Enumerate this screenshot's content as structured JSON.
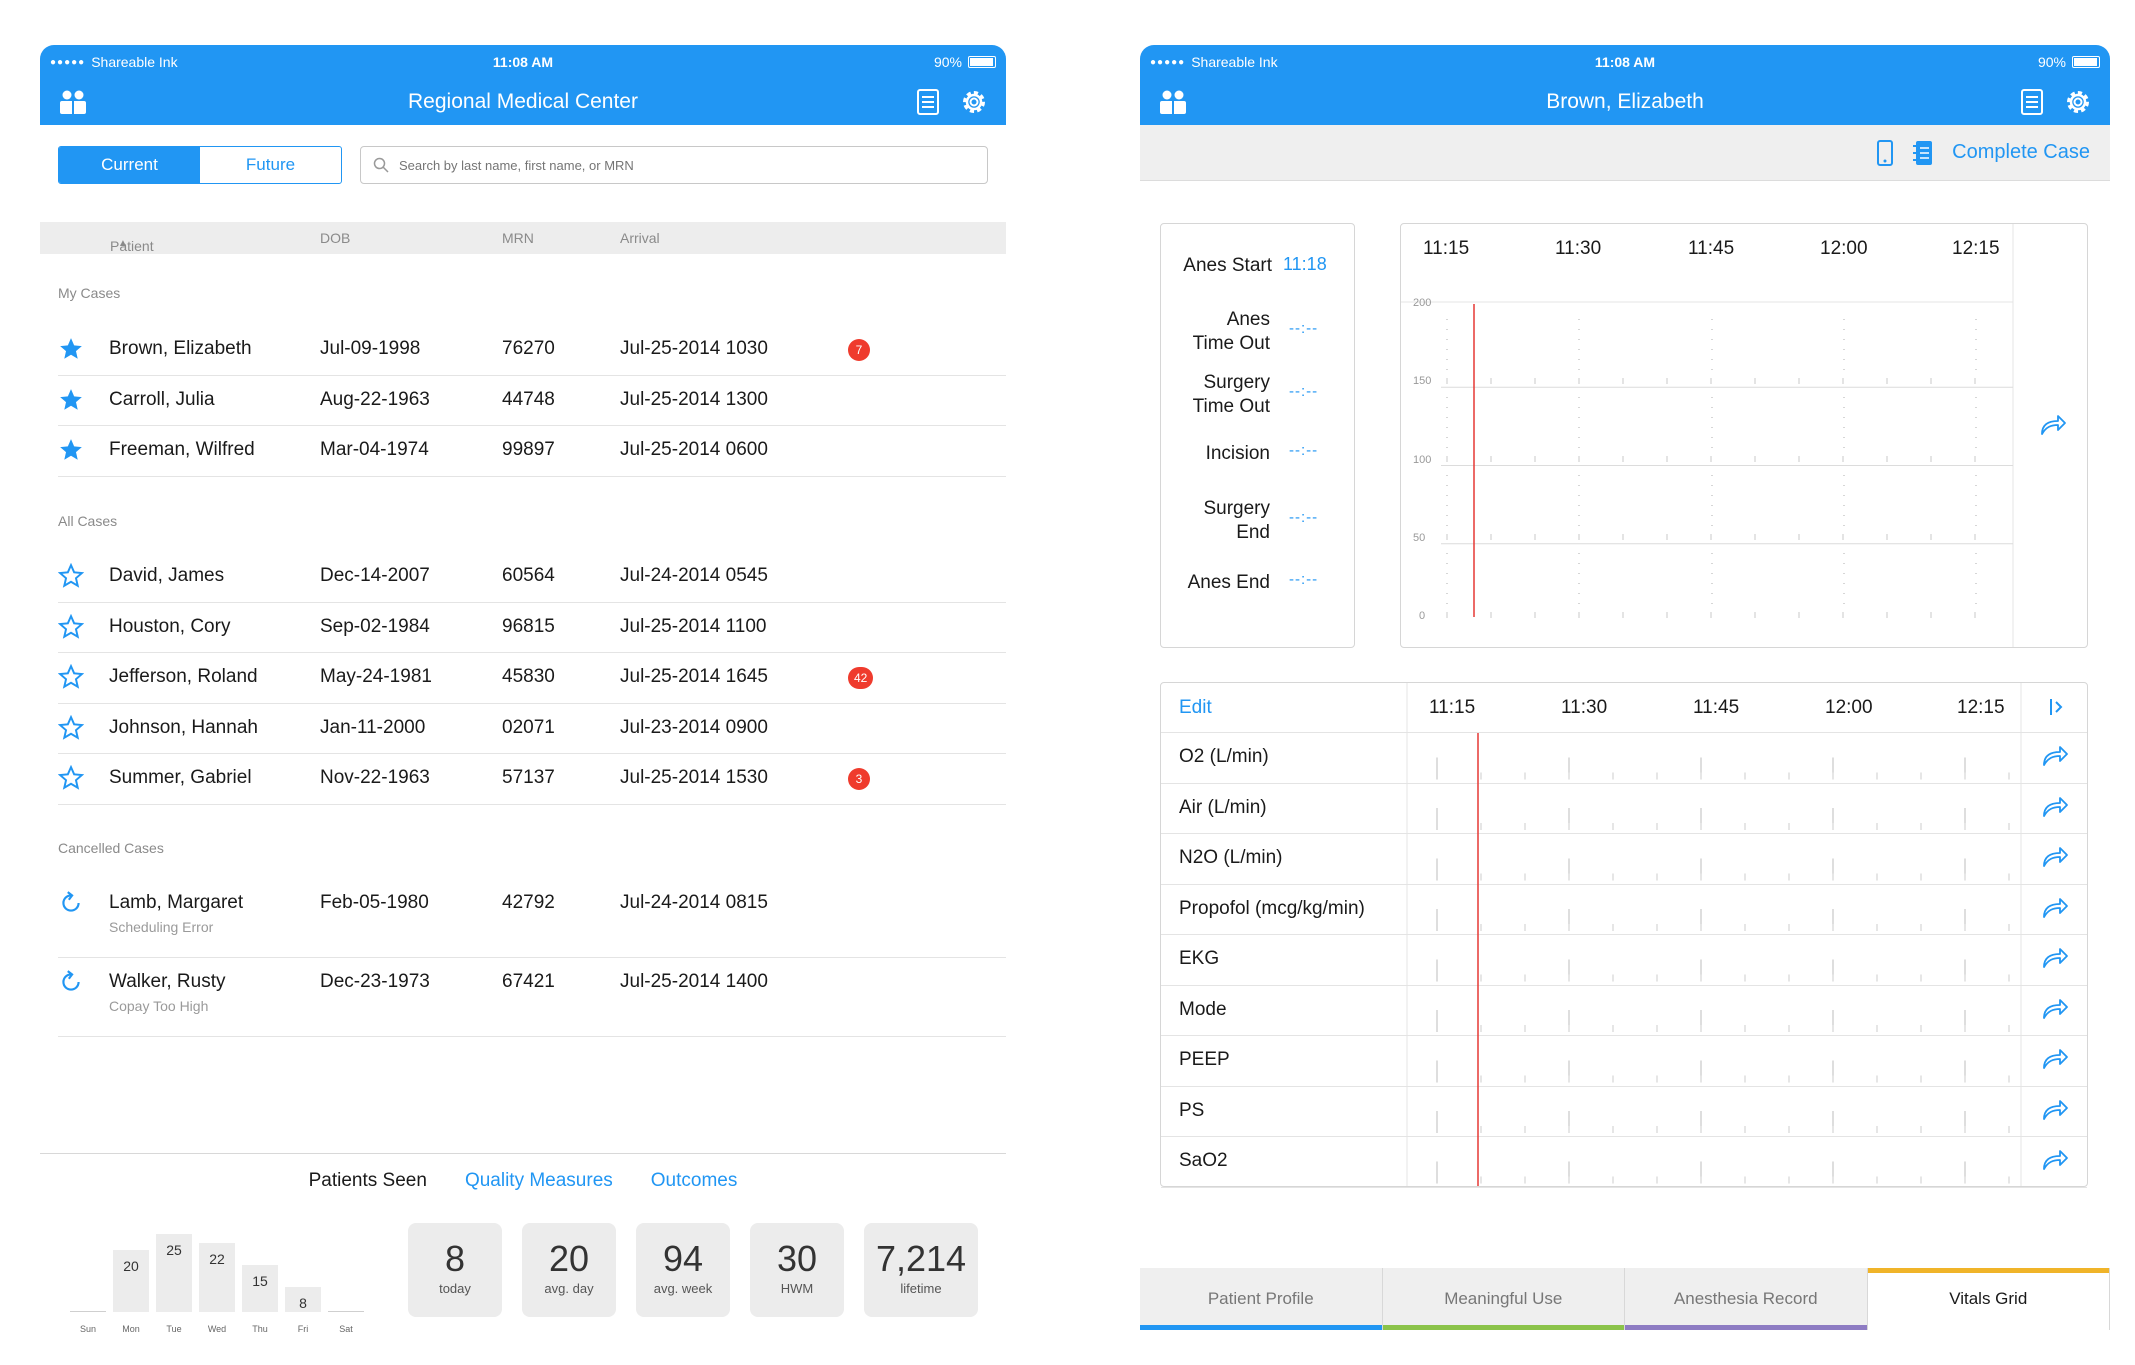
{
  "status": {
    "carrier": "Shareable Ink",
    "time": "11:08 AM",
    "battery": "90%"
  },
  "left": {
    "title": "Regional Medical Center",
    "segment": {
      "current": "Current",
      "future": "Future"
    },
    "search_placeholder": "Search by last name, first name, or MRN",
    "columns": {
      "patient": "Patient",
      "dob": "DOB",
      "mrn": "MRN",
      "arrival": "Arrival"
    },
    "sections": {
      "my": "My Cases",
      "all": "All Cases",
      "cancelled": "Cancelled Cases"
    },
    "my_cases": [
      {
        "name": "Brown, Elizabeth",
        "dob": "Jul-09-1998",
        "mrn": "76270",
        "arrival": "Jul-25-2014 1030",
        "badge": "7"
      },
      {
        "name": "Carroll, Julia",
        "dob": "Aug-22-1963",
        "mrn": "44748",
        "arrival": "Jul-25-2014 1300",
        "badge": ""
      },
      {
        "name": "Freeman, Wilfred",
        "dob": "Mar-04-1974",
        "mrn": "99897",
        "arrival": "Jul-25-2014 0600",
        "badge": ""
      }
    ],
    "all_cases": [
      {
        "name": "David, James",
        "dob": "Dec-14-2007",
        "mrn": "60564",
        "arrival": "Jul-24-2014 0545",
        "badge": ""
      },
      {
        "name": "Houston, Cory",
        "dob": "Sep-02-1984",
        "mrn": "96815",
        "arrival": "Jul-25-2014 1100",
        "badge": ""
      },
      {
        "name": "Jefferson, Roland",
        "dob": "May-24-1981",
        "mrn": "45830",
        "arrival": "Jul-25-2014 1645",
        "badge": "42"
      },
      {
        "name": "Johnson, Hannah",
        "dob": "Jan-11-2000",
        "mrn": "02071",
        "arrival": "Jul-23-2014 0900",
        "badge": ""
      },
      {
        "name": "Summer, Gabriel",
        "dob": "Nov-22-1963",
        "mrn": "57137",
        "arrival": "Jul-25-2014 1530",
        "badge": "3"
      }
    ],
    "cancelled_cases": [
      {
        "name": "Lamb, Margaret",
        "dob": "Feb-05-1980",
        "mrn": "42792",
        "arrival": "Jul-24-2014 0815",
        "reason": "Scheduling Error"
      },
      {
        "name": "Walker, Rusty",
        "dob": "Dec-23-1973",
        "mrn": "67421",
        "arrival": "Jul-25-2014 1400",
        "reason": "Copay Too High"
      }
    ],
    "bottom_tabs": {
      "patients_seen": "Patients Seen",
      "quality": "Quality Measures",
      "outcomes": "Outcomes"
    },
    "weekly": [
      {
        "day": "Sun",
        "value": 0
      },
      {
        "day": "Mon",
        "value": 20
      },
      {
        "day": "Tue",
        "value": 25
      },
      {
        "day": "Wed",
        "value": 22
      },
      {
        "day": "Thu",
        "value": 15
      },
      {
        "day": "Fri",
        "value": 8
      },
      {
        "day": "Sat",
        "value": 0
      }
    ],
    "stats": [
      {
        "value": "8",
        "label": "today"
      },
      {
        "value": "20",
        "label": "avg. day"
      },
      {
        "value": "94",
        "label": "avg. week"
      },
      {
        "value": "30",
        "label": "HWM"
      },
      {
        "value": "7,214",
        "label": "lifetime"
      }
    ]
  },
  "right": {
    "title": "Brown, Elizabeth",
    "complete_case": "Complete Case",
    "events": [
      {
        "label": "Anes Start",
        "time": "11:18"
      },
      {
        "label": "Anes\nTime Out",
        "time": "--:--"
      },
      {
        "label": "Surgery\nTime Out",
        "time": "--:--"
      },
      {
        "label": "Incision",
        "time": "--:--"
      },
      {
        "label": "Surgery\nEnd",
        "time": "--:--"
      },
      {
        "label": "Anes End",
        "time": "--:--"
      }
    ],
    "times": [
      "11:15",
      "11:30",
      "11:45",
      "12:00",
      "12:15"
    ],
    "y_ticks": [
      "200",
      "150",
      "100",
      "50",
      "0"
    ],
    "edit": "Edit",
    "grid_rows": [
      "O2 (L/min)",
      "Air (L/min)",
      "N2O (L/min)",
      "Propofol (mcg/kg/min)",
      "EKG",
      "Mode",
      "PEEP",
      "PS",
      "SaO2"
    ],
    "tabs": [
      {
        "label": "Patient Profile",
        "color": "#2196f3"
      },
      {
        "label": "Meaningful Use",
        "color": "#8bc34a"
      },
      {
        "label": "Anesthesia Record",
        "color": "#8e7cc3"
      },
      {
        "label": "Vitals Grid",
        "color": "#f0b429"
      }
    ]
  },
  "colors": {
    "accent": "#2196f3",
    "badge": "#ef3b2d",
    "marker": "#e53935"
  }
}
